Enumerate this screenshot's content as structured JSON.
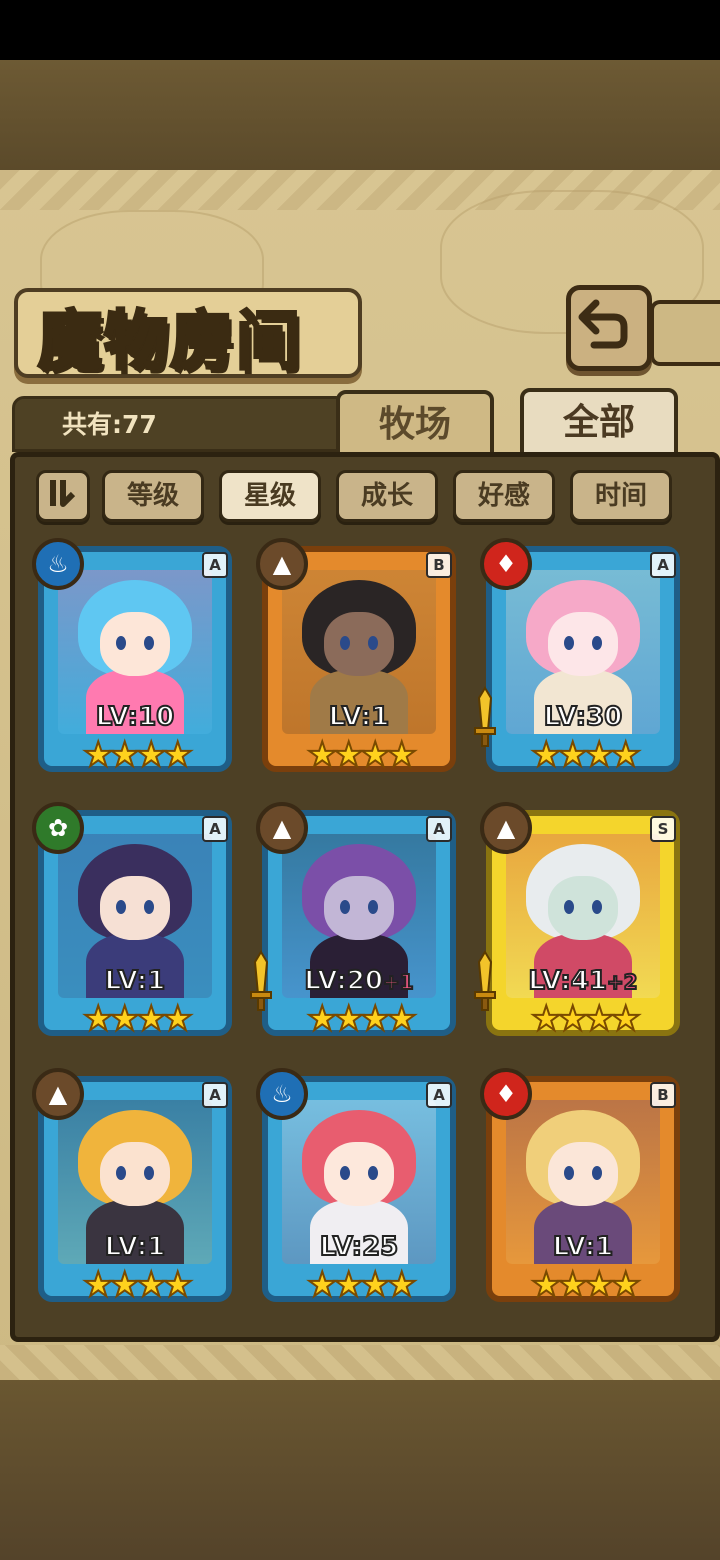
{
  "title": "魔物房间",
  "count_label": "共有:77",
  "tabs": {
    "ranch": "牧场",
    "all": "全部"
  },
  "sort_buttons": [
    "等级",
    "星级",
    "成长",
    "好感",
    "时间"
  ],
  "active_sort": "星级",
  "cards": [
    {
      "element": "water",
      "rank": "A",
      "frame": "blue",
      "level": "LV:10",
      "plus": "",
      "stars": 4,
      "weapon": false,
      "hair": "#5fc7f2",
      "skin": "#fde6d8",
      "body": "#ff7ab0"
    },
    {
      "element": "earth",
      "rank": "B",
      "frame": "orange",
      "level": "LV:1",
      "plus": "",
      "stars": 4,
      "weapon": false,
      "hair": "#2a2525",
      "skin": "#8b6b5a",
      "body": "#a07a47"
    },
    {
      "element": "fire",
      "rank": "A",
      "frame": "blue",
      "level": "LV:30",
      "plus": "",
      "stars": 4,
      "weapon": true,
      "hair": "#f6a9c8",
      "skin": "#fde6e8",
      "body": "#f2e6d2"
    },
    {
      "element": "nature",
      "rank": "A",
      "frame": "blue",
      "level": "LV:1",
      "plus": "",
      "stars": 4,
      "weapon": false,
      "hair": "#3a2f5e",
      "skin": "#f6e0d4",
      "body": "#3b3c7a"
    },
    {
      "element": "earth",
      "rank": "A",
      "frame": "blue",
      "level": "LV:20",
      "plus": "+1",
      "stars": 4,
      "weapon": true,
      "hair": "#7b4fa8",
      "skin": "#c2b6d6",
      "body": "#2a1f35"
    },
    {
      "element": "earth",
      "rank": "S",
      "frame": "gold",
      "level": "LV:41",
      "plus": "+2",
      "stars": 4,
      "weapon": true,
      "hair": "#e8ecee",
      "skin": "#cfe3da",
      "body": "#d04a66"
    },
    {
      "element": "earth",
      "rank": "A",
      "frame": "blue",
      "level": "LV:1",
      "plus": "",
      "stars": 4,
      "weapon": false,
      "hair": "#f0b43c",
      "skin": "#fbe2cf",
      "body": "#3a3440"
    },
    {
      "element": "water",
      "rank": "A",
      "frame": "blue",
      "level": "LV:25",
      "plus": "",
      "stars": 4,
      "weapon": false,
      "hair": "#e85d6f",
      "skin": "#fde8dc",
      "body": "#f0eef2"
    },
    {
      "element": "fire",
      "rank": "B",
      "frame": "orange",
      "level": "LV:1",
      "plus": "",
      "stars": 4,
      "weapon": false,
      "hair": "#f0cf7a",
      "skin": "#fbe6d8",
      "body": "#6a4a7a"
    }
  ],
  "element_icons": {
    "water": "♨",
    "earth": "▲",
    "fire": "♦",
    "nature": "✿"
  },
  "element_colors": {
    "water": "#1f6fb5",
    "earth": "#6b4a2a",
    "fire": "#d0251c",
    "nature": "#2f7a2a"
  }
}
